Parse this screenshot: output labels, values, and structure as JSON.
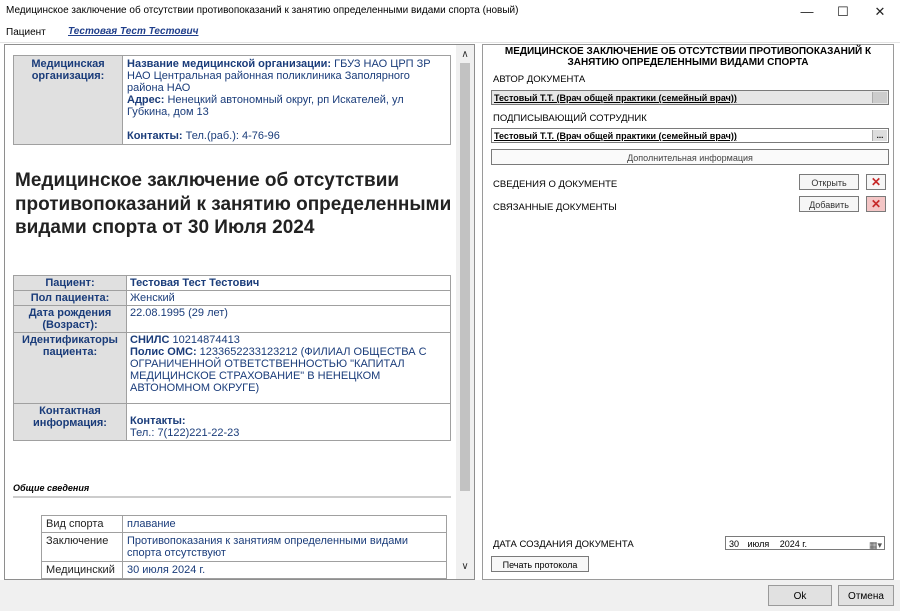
{
  "window": {
    "title": "Медицинское заключение об отсутствии противопоказаний к занятию определенными видами спорта (новый)",
    "minimize": "—",
    "maximize": "☐",
    "close": "✕"
  },
  "patient_bar": {
    "label": "Пациент",
    "name": "Тестовая Тест Тестович"
  },
  "org": {
    "header": "Медицинская организация:",
    "name_key": "Название медицинской организации:",
    "name_val": "ГБУЗ НАО ЦРП ЗР НАО Центральная районная поликлиника Заполярного района НАО",
    "addr_key": "Адрес:",
    "addr_val": "Ненецкий автономный округ, рп Искателей, ул Губкина, дом 13",
    "contacts_key": "Контакты:",
    "contacts_val": "Тел.(раб.): 4-76-96"
  },
  "doc_title": "Медицинское заключение об отсутствии противопоказаний к занятию определенными видами спорта от 30 Июля 2024",
  "patient_table": {
    "r1h": "Пациент:",
    "r1v": "Тестовая Тест Тестович",
    "r2h": "Пол пациента:",
    "r2v": "Женский",
    "r3h": "Дата рождения (Возраст):",
    "r3v": "22.08.1995 (29 лет)",
    "r4h": "Идентификаторы пациента:",
    "snils_key": "СНИЛС",
    "snils_val": "10214874413",
    "oms_key": "Полис ОМС:",
    "oms_val": "1233652233123212 (ФИЛИАЛ ОБЩЕСТВА С ОГРАНИЧЕННОЙ ОТВЕТСТВЕННОСТЬЮ \"КАПИТАЛ МЕДИЦИНСКОЕ СТРАХОВАНИЕ\" В НЕНЕЦКОМ АВТОНОМНОМ ОКРУГЕ)",
    "r5h": "Контактная информация:",
    "cont_key": "Контакты:",
    "cont_val": "Тел.: 7(122)221-22-23"
  },
  "section": "Общие сведения",
  "general": {
    "r1h": "Вид спорта",
    "r1v": "плавание",
    "r2h": "Заключение",
    "r2v": "Противопоказания к занятиям определенными видами спорта отсутствуют",
    "r3h": "Медицинский",
    "r3v": "30 июля 2024 г."
  },
  "scroll": {
    "up": "∧",
    "down": "∨"
  },
  "right": {
    "title": "МЕДИЦИНСКОЕ ЗАКЛЮЧЕНИЕ ОБ ОТСУТСТВИИ ПРОТИВОПОКАЗАНИЙ К ЗАНЯТИЮ ОПРЕДЕЛЕННЫМИ ВИДАМИ СПОРТА",
    "author_label": "АВТОР ДОКУМЕНТА",
    "author_value": "Тестовый Т.Т. (Врач общей практики (семейный врач))",
    "signer_label": "ПОДПИСЫВАЮЩИЙ СОТРУДНИК",
    "signer_value": "Тестовый Т.Т. (Врач общей практики (семейный врач))",
    "ellipsis": "...",
    "extra_info": "Дополнительная информация",
    "doc_info_label": "СВЕДЕНИЯ О ДОКУМЕНТЕ",
    "open_btn": "Открыть",
    "related_label": "СВЯЗАННЫЕ ДОКУМЕНТЫ",
    "add_btn": "Добавить",
    "remove": "✕",
    "created_label": "ДАТА СОЗДАНИЯ ДОКУМЕНТА",
    "date_day": "30",
    "date_month": "июля",
    "date_year": "2024 г.",
    "cal_icon": "▦▾",
    "print_btn": "Печать протокола"
  },
  "footer": {
    "ok": "Ok",
    "cancel": "Отмена"
  }
}
